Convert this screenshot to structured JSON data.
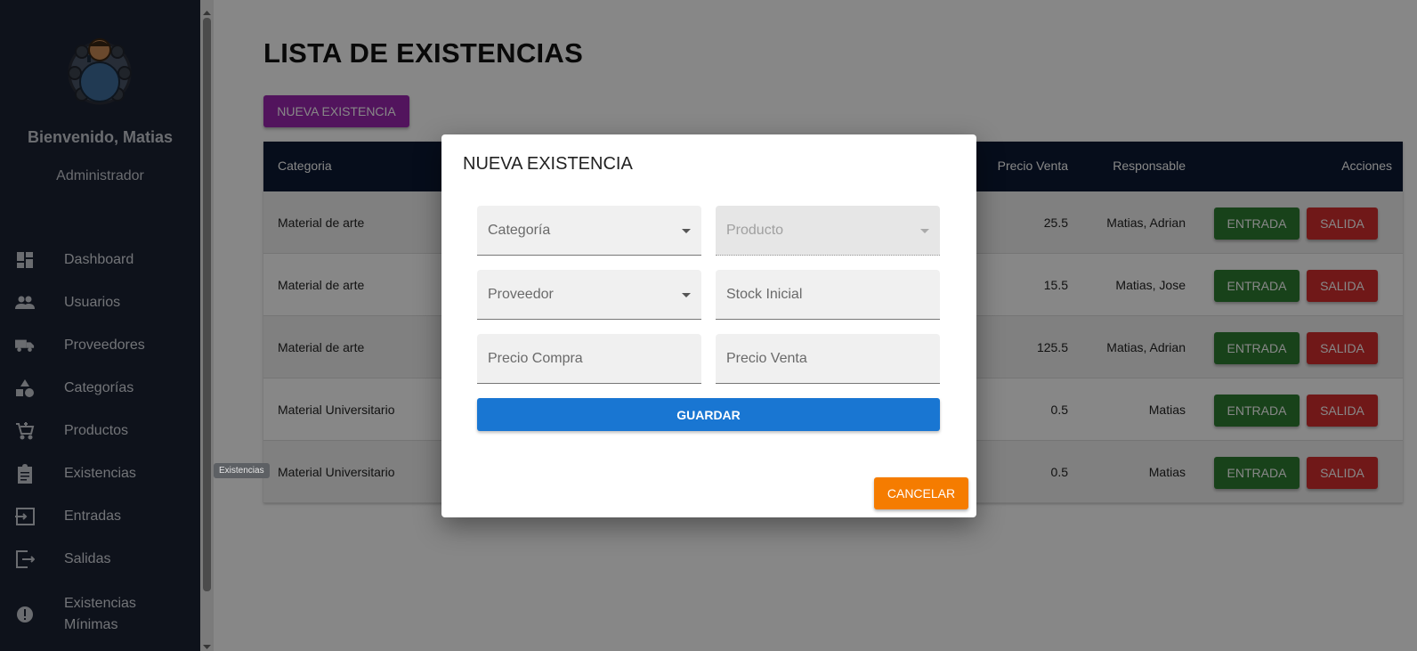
{
  "sidebar": {
    "welcome": "Bienvenido, Matias",
    "role": "Administrador",
    "items": [
      {
        "label": "Dashboard",
        "icon": "dashboard-icon"
      },
      {
        "label": "Usuarios",
        "icon": "users-icon"
      },
      {
        "label": "Proveedores",
        "icon": "truck-icon"
      },
      {
        "label": "Categorías",
        "icon": "category-icon"
      },
      {
        "label": "Productos",
        "icon": "cart-icon"
      },
      {
        "label": "Existencias",
        "icon": "clipboard-icon"
      },
      {
        "label": "Entradas",
        "icon": "login-icon"
      },
      {
        "label": "Salidas",
        "icon": "logout-icon"
      },
      {
        "label": "Existencias Mínimas",
        "icon": "alert-icon"
      }
    ],
    "tooltip": "Existencias"
  },
  "main": {
    "title": "LISTA DE EXISTENCIAS",
    "new_button": "NUEVA EXISTENCIA",
    "table": {
      "headers": {
        "categoria": "Categoria",
        "precio_venta": "Precio Venta",
        "responsable": "Responsable",
        "acciones": "Acciones"
      },
      "rows": [
        {
          "categoria": "Material de arte",
          "precio_venta": "25.5",
          "responsable": "Matias, Adrian"
        },
        {
          "categoria": "Material de arte",
          "precio_venta": "15.5",
          "responsable": "Matias, Jose"
        },
        {
          "categoria": "Material de arte",
          "precio_venta": "125.5",
          "responsable": "Matias, Adrian"
        },
        {
          "categoria": "Material Universitario",
          "precio_venta": "0.5",
          "responsable": "Matias"
        },
        {
          "categoria": "Material Universitario",
          "precio_venta": "0.5",
          "responsable": "Matias"
        }
      ],
      "entrada_label": "ENTRADA",
      "salida_label": "SALIDA"
    }
  },
  "dialog": {
    "title": "NUEVA EXISTENCIA",
    "fields": {
      "categoria": "Categoría",
      "producto": "Producto",
      "proveedor": "Proveedor",
      "stock_inicial": "Stock Inicial",
      "precio_compra": "Precio Compra",
      "precio_venta": "Precio Venta"
    },
    "save_label": "GUARDAR",
    "cancel_label": "CANCELAR"
  },
  "colors": {
    "sidebar_bg": "#1b2233",
    "table_header": "#0c1a33",
    "new_button": "#9c27b0",
    "entrada": "#2e7d32",
    "salida": "#d32f2f",
    "save": "#1976d2",
    "cancel": "#f57c00"
  }
}
